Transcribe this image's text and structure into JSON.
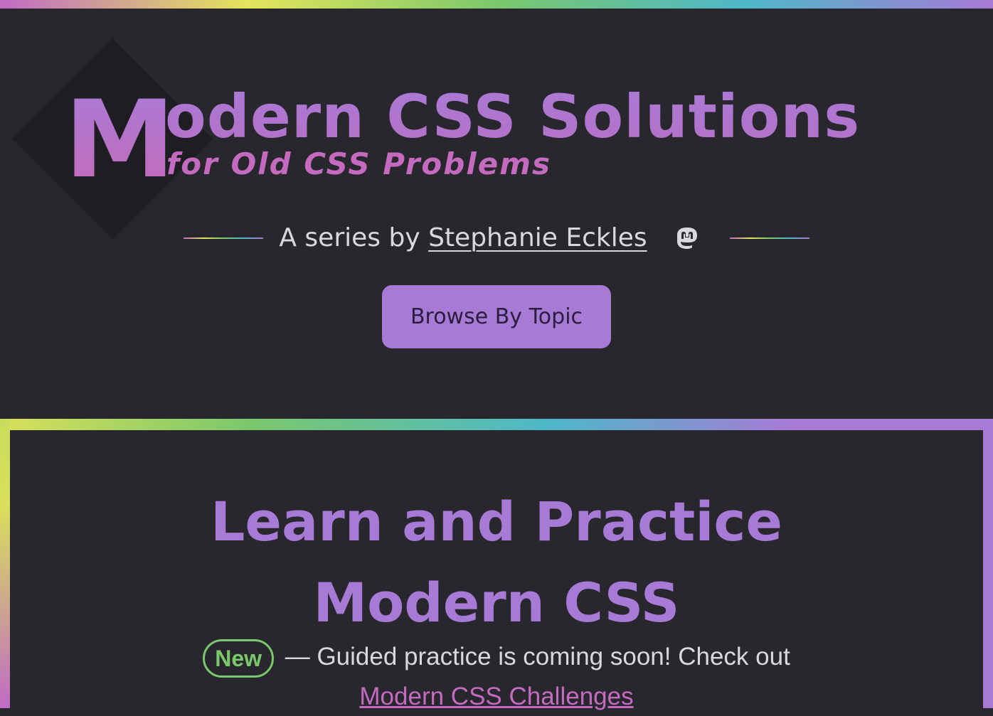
{
  "header": {
    "title_initial": "M",
    "title_rest": "odern CSS Solutions",
    "subtitle": "for Old CSS Problems",
    "byline_prefix": "A series by",
    "author": "Stephanie Eckles",
    "social_icon": "mastodon-icon",
    "browse_button": "Browse By Topic"
  },
  "practice": {
    "title_line1": "Learn and Practice",
    "title_line2": "Modern CSS",
    "badge": "New",
    "text": " — Guided practice is coming soon! Check out",
    "link": "Modern CSS Challenges"
  },
  "colors": {
    "background": "#28272d",
    "accent_purple": "#a77ad6",
    "accent_pink": "#c46bc0",
    "accent_green": "#7bc86c",
    "text": "#d9d8de"
  }
}
